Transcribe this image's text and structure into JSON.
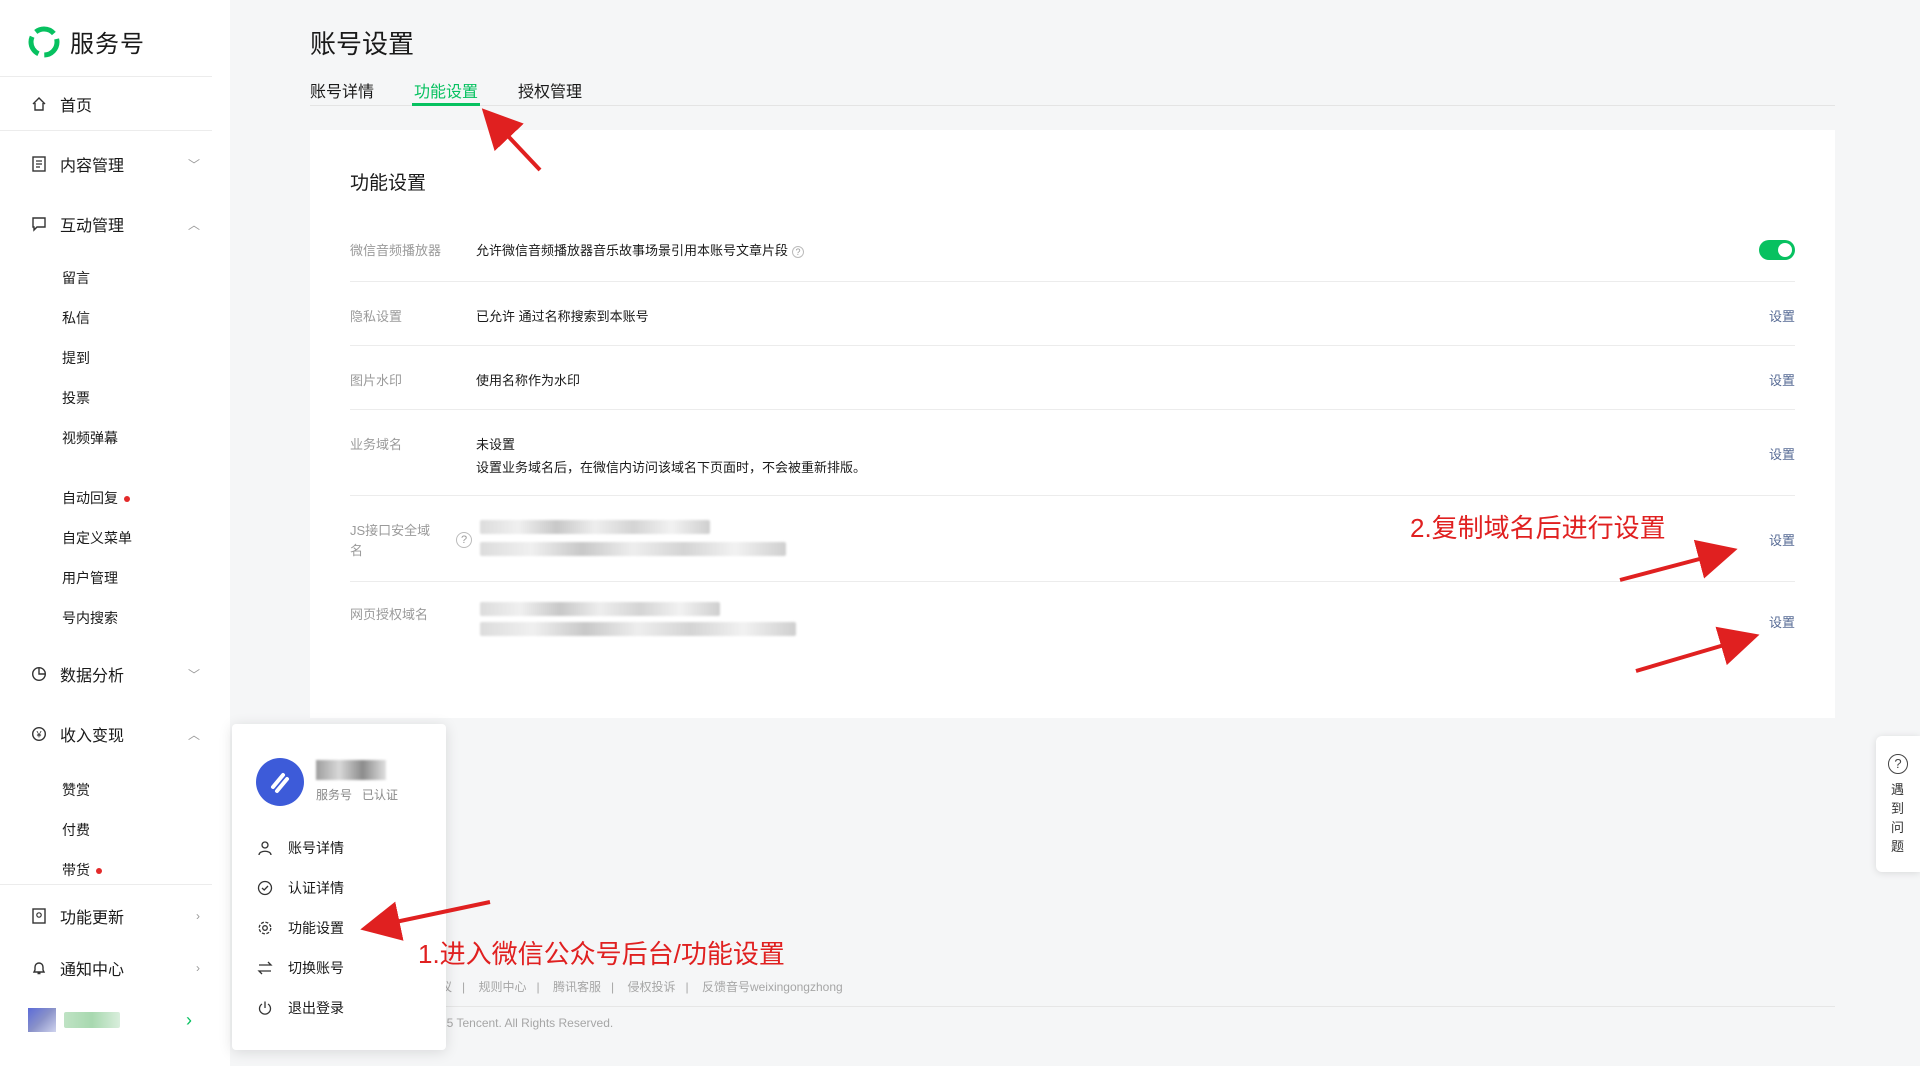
{
  "brand": {
    "name": "服务号",
    "accent": "#07c160"
  },
  "sidebar": {
    "home": "首页",
    "content": "内容管理",
    "interaction": "互动管理",
    "interaction_items": [
      "留言",
      "私信",
      "提到",
      "投票",
      "视频弹幕"
    ],
    "interaction_items2": [
      "自动回复",
      "自定义菜单",
      "用户管理",
      "号内搜索"
    ],
    "analytics": "数据分析",
    "monetize": "收入变现",
    "monetize_items": [
      "赞赏",
      "付费",
      "带货"
    ],
    "updates": "功能更新",
    "notifications": "通知中心"
  },
  "page": {
    "title": "账号设置",
    "tabs": [
      "账号详情",
      "功能设置",
      "授权管理"
    ],
    "active_tab": "功能设置"
  },
  "card": {
    "title": "功能设置",
    "rows": [
      {
        "label": "微信音频播放器",
        "value": "允许微信音频播放器音乐故事场景引用本账号文章片段",
        "toggle": true
      },
      {
        "label": "隐私设置",
        "value": "已允许 通过名称搜索到本账号",
        "action": "设置"
      },
      {
        "label": "图片水印",
        "value": "使用名称作为水印",
        "action": "设置"
      },
      {
        "label": "业务域名",
        "value": "未设置",
        "value2": "设置业务域名后，在微信内访问该域名下页面时，不会被重新排版。",
        "action": "设置"
      },
      {
        "label": "JS接口安全域",
        "label2": "名",
        "action": "设置"
      },
      {
        "label": "网页授权域名",
        "action": "设置"
      }
    ]
  },
  "popup": {
    "meta1": "服务号",
    "meta2": "已认证",
    "items": [
      "账号详情",
      "认证详情",
      "功能设置",
      "切换账号",
      "退出登录"
    ]
  },
  "footer": {
    "links": [
      "议",
      "规则中心",
      "腾讯客服",
      "侵权投诉",
      "反馈音号weixingongzhong"
    ],
    "copyright": "25 Tencent. All Rights Reserved."
  },
  "help_float": {
    "text": "遇到问题"
  },
  "annotations": {
    "step1": "1.进入微信公众号后台/功能设置",
    "step2": "2.复制域名后进行设置",
    "color": "#e02020"
  }
}
